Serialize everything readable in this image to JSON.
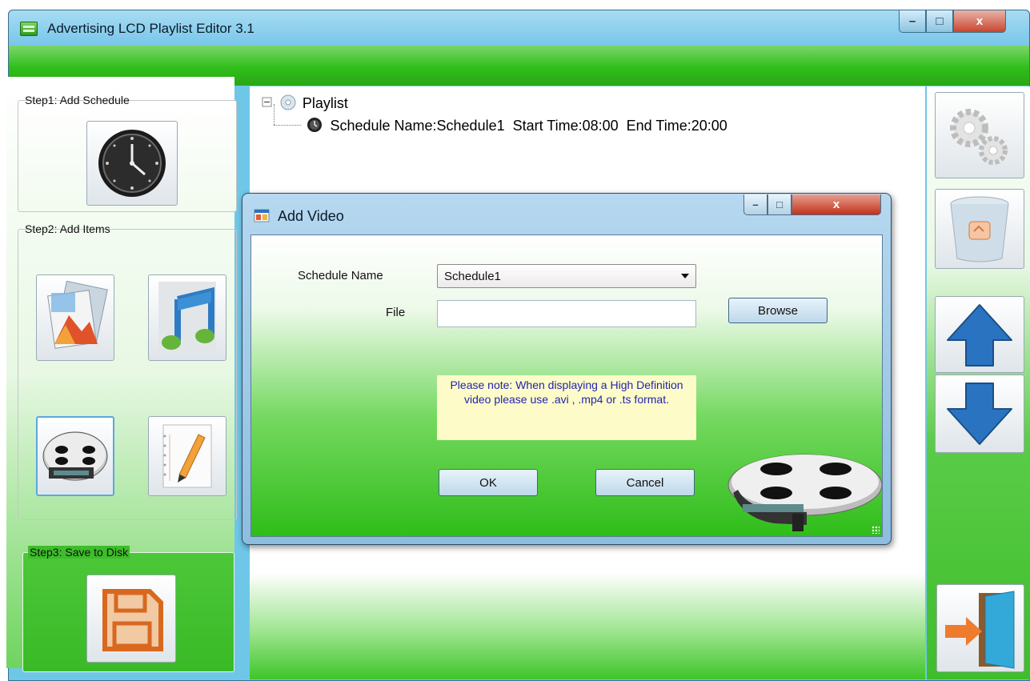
{
  "window": {
    "title": "Advertising LCD Playlist Editor 3.1",
    "controls": {
      "minimize": "–",
      "maximize": "□",
      "close": "x"
    }
  },
  "steps": {
    "step1": "Step1: Add Schedule",
    "step2": "Step2: Add Items",
    "step3": "Step3: Save to Disk"
  },
  "tree": {
    "root": "Playlist",
    "schedule": "Schedule Name:Schedule1  Start Time:08:00  End Time:20:00"
  },
  "dialog": {
    "title": "Add Video",
    "controls": {
      "minimize": "–",
      "maximize": "□",
      "close": "x"
    },
    "schedule_label": "Schedule Name",
    "schedule_value": "Schedule1",
    "file_label": "File",
    "file_value": "",
    "browse_label": "Browse",
    "note": "Please note: When displaying a High Definition video please use .avi , .mp4 or .ts format.",
    "ok_label": "OK",
    "cancel_label": "Cancel"
  },
  "colors": {
    "accent_green": "#3fbd2b",
    "title_blue": "#78c6e9",
    "note_bg": "#fdfcc9",
    "note_text": "#2323b0"
  },
  "icons": {
    "add_schedule": "clock-icon",
    "add_image": "image-icon",
    "add_music": "music-note-icon",
    "add_video": "film-reel-icon",
    "add_text": "notepad-pencil-icon",
    "save": "floppy-disk-icon",
    "settings": "gears-icon",
    "delete": "recycle-bin-icon",
    "move_up": "arrow-up-icon",
    "move_down": "arrow-down-icon",
    "exit": "exit-door-icon"
  }
}
